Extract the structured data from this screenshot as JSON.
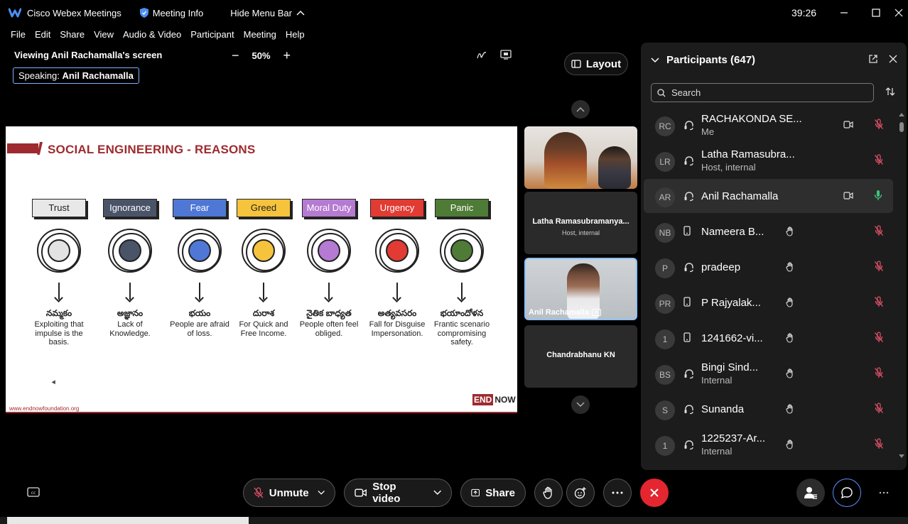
{
  "titlebar": {
    "app_name": "Cisco Webex Meetings",
    "meeting_info": "Meeting Info",
    "hide_menu": "Hide Menu Bar",
    "timer": "39:26"
  },
  "menu": [
    "File",
    "Edit",
    "Share",
    "View",
    "Audio & Video",
    "Participant",
    "Meeting",
    "Help"
  ],
  "share": {
    "viewing": "Viewing Anil Rachamalla's screen",
    "zoom": "50%",
    "speaking_label": "Speaking:",
    "speaking_name": "Anil Rachamalla"
  },
  "slide": {
    "title": "SOCIAL ENGINEERING -  REASONS",
    "url": "www.endnowfoundation.org",
    "brand_end": "END",
    "brand_now": "NOW",
    "columns": [
      {
        "label": "Trust",
        "label_bg": "#e8e8e8",
        "label_fg": "#222222",
        "dot": "#e3e3e3",
        "telugu": "నమ్మకం",
        "desc": "Exploiting that impulse is the basis."
      },
      {
        "label": "Ignorance",
        "label_bg": "#4a5469",
        "label_fg": "#ffffff",
        "dot": "#4a5469",
        "telugu": "అజ్ఞానం",
        "desc": "Lack of Knowledge."
      },
      {
        "label": "Fear",
        "label_bg": "#4f78d6",
        "label_fg": "#ffffff",
        "dot": "#4f78d6",
        "telugu": "భయం",
        "desc": "People are afraid of loss."
      },
      {
        "label": "Greed",
        "label_bg": "#f6c33c",
        "label_fg": "#222222",
        "dot": "#f6c33c",
        "telugu": "దురాశ",
        "desc": "For Quick and Free Income."
      },
      {
        "label": "Moral Duty",
        "label_bg": "#b57ad1",
        "label_fg": "#ffffff",
        "dot": "#b57ad1",
        "telugu": "నైతిక బాధ్యత",
        "desc": "People often feel obliged."
      },
      {
        "label": "Urgency",
        "label_bg": "#e13b33",
        "label_fg": "#ffffff",
        "dot": "#e13b33",
        "telugu": "అత్యవసరం",
        "desc": "Fall for Disguise Impersonation."
      },
      {
        "label": "Panic",
        "label_bg": "#4e7b36",
        "label_fg": "#ffffff",
        "dot": "#4e7b36",
        "telugu": "భయాందోళన",
        "desc": "Frantic scenario compromising safety."
      }
    ]
  },
  "videos": {
    "layout_label": "Layout",
    "tile2_name": "Latha Ramasubramanya...",
    "tile2_role": "Host, internal",
    "tile3_name": "Anil Rachamalla",
    "tile4_name": "Chandrabhanu KN"
  },
  "participants": {
    "header": "Participants (647)",
    "search_placeholder": "Search",
    "list": [
      {
        "initials": "RC",
        "name": "RACHAKONDA SE...",
        "role": "Me",
        "device": "headset",
        "hand": false,
        "cam": true,
        "mic": "muted"
      },
      {
        "initials": "LR",
        "name": "Latha Ramasubra...",
        "role": "Host, internal",
        "device": "headset",
        "hand": false,
        "cam": false,
        "mic": "muted"
      },
      {
        "initials": "AR",
        "name": "Anil Rachamalla",
        "role": "",
        "device": "headset",
        "hand": false,
        "cam": true,
        "mic": "active"
      },
      {
        "initials": "NB",
        "name": "Nameera B...",
        "role": "",
        "device": "phone",
        "hand": true,
        "cam": false,
        "mic": "muted"
      },
      {
        "initials": "P",
        "name": "pradeep",
        "role": "",
        "device": "headset",
        "hand": true,
        "cam": false,
        "mic": "muted"
      },
      {
        "initials": "PR",
        "name": "P Rajyalak...",
        "role": "",
        "device": "phone",
        "hand": true,
        "cam": false,
        "mic": "muted"
      },
      {
        "initials": "1",
        "name": "1241662-vi...",
        "role": "",
        "device": "phone",
        "hand": true,
        "cam": false,
        "mic": "muted"
      },
      {
        "initials": "BS",
        "name": "Bingi Sind...",
        "role": "Internal",
        "device": "headset",
        "hand": true,
        "cam": false,
        "mic": "muted"
      },
      {
        "initials": "S",
        "name": "Sunanda",
        "role": "",
        "device": "headset",
        "hand": true,
        "cam": false,
        "mic": "muted"
      },
      {
        "initials": "1",
        "name": "1225237-Ar...",
        "role": "Internal",
        "device": "headset",
        "hand": true,
        "cam": false,
        "mic": "muted"
      }
    ]
  },
  "controls": {
    "unmute": "Unmute",
    "stop_video": "Stop video",
    "share": "Share"
  },
  "colors": {
    "end_red": "#e3262f",
    "brand_red": "#9e2a2f",
    "muted_mic": "#e6526a",
    "active_mic": "#3fc37a"
  }
}
